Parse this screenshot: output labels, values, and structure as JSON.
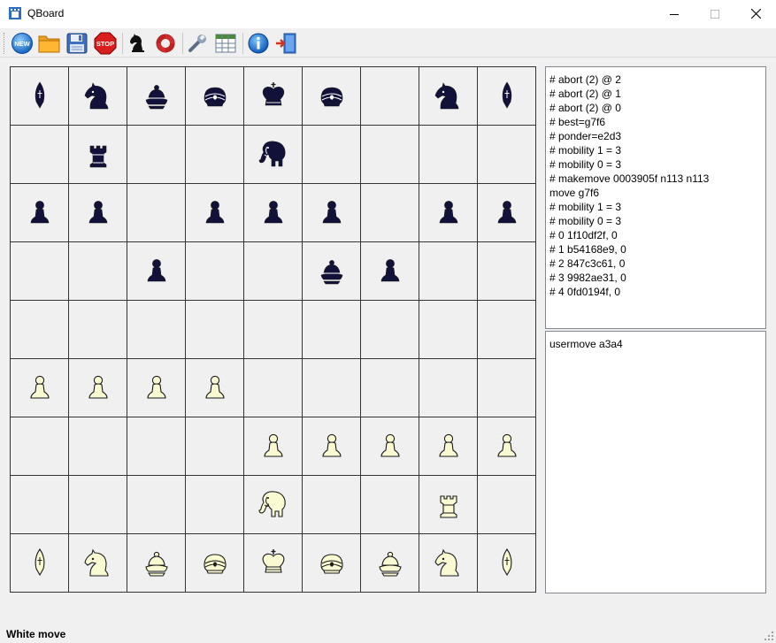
{
  "window": {
    "title": "QBoard",
    "controls": [
      "minimize",
      "maximize",
      "close"
    ]
  },
  "toolbar": {
    "buttons": [
      {
        "name": "new",
        "icon": "new-icon",
        "text": "NEW"
      },
      {
        "name": "open",
        "icon": "folder-icon"
      },
      {
        "name": "save",
        "icon": "floppy-icon"
      },
      {
        "name": "stop",
        "icon": "stop-icon",
        "text": "STOP"
      },
      {
        "name": "engine",
        "icon": "knight-icon"
      },
      {
        "name": "help-engine",
        "icon": "lifebuoy-icon"
      },
      {
        "name": "settings",
        "icon": "wrench-icon"
      },
      {
        "name": "table",
        "icon": "table-icon"
      },
      {
        "name": "about",
        "icon": "info-icon"
      },
      {
        "name": "exit",
        "icon": "exit-icon"
      }
    ]
  },
  "board": {
    "files": 9,
    "ranks": 9,
    "colors": {
      "dark_side": "#11113a",
      "light_side": "#fafad2",
      "outline": "#1a1a1a",
      "grid": "#333333"
    },
    "pieces": [
      {
        "row": 0,
        "col": 0,
        "side": "dark",
        "type": "bishop"
      },
      {
        "row": 0,
        "col": 1,
        "side": "dark",
        "type": "knight"
      },
      {
        "row": 0,
        "col": 2,
        "side": "dark",
        "type": "general"
      },
      {
        "row": 0,
        "col": 3,
        "side": "dark",
        "type": "turban"
      },
      {
        "row": 0,
        "col": 4,
        "side": "dark",
        "type": "king"
      },
      {
        "row": 0,
        "col": 5,
        "side": "dark",
        "type": "turban"
      },
      {
        "row": 0,
        "col": 7,
        "side": "dark",
        "type": "knight"
      },
      {
        "row": 0,
        "col": 8,
        "side": "dark",
        "type": "bishop"
      },
      {
        "row": 1,
        "col": 1,
        "side": "dark",
        "type": "rook"
      },
      {
        "row": 1,
        "col": 4,
        "side": "dark",
        "type": "elephant"
      },
      {
        "row": 2,
        "col": 0,
        "side": "dark",
        "type": "pawn"
      },
      {
        "row": 2,
        "col": 1,
        "side": "dark",
        "type": "pawn"
      },
      {
        "row": 2,
        "col": 3,
        "side": "dark",
        "type": "pawn"
      },
      {
        "row": 2,
        "col": 4,
        "side": "dark",
        "type": "pawn"
      },
      {
        "row": 2,
        "col": 5,
        "side": "dark",
        "type": "pawn"
      },
      {
        "row": 2,
        "col": 7,
        "side": "dark",
        "type": "pawn"
      },
      {
        "row": 2,
        "col": 8,
        "side": "dark",
        "type": "pawn"
      },
      {
        "row": 3,
        "col": 2,
        "side": "dark",
        "type": "pawn"
      },
      {
        "row": 3,
        "col": 5,
        "side": "dark",
        "type": "general"
      },
      {
        "row": 3,
        "col": 6,
        "side": "dark",
        "type": "pawn"
      },
      {
        "row": 5,
        "col": 0,
        "side": "light",
        "type": "pawn"
      },
      {
        "row": 5,
        "col": 1,
        "side": "light",
        "type": "pawn"
      },
      {
        "row": 5,
        "col": 2,
        "side": "light",
        "type": "pawn"
      },
      {
        "row": 5,
        "col": 3,
        "side": "light",
        "type": "pawn"
      },
      {
        "row": 6,
        "col": 4,
        "side": "light",
        "type": "pawn"
      },
      {
        "row": 6,
        "col": 5,
        "side": "light",
        "type": "pawn"
      },
      {
        "row": 6,
        "col": 6,
        "side": "light",
        "type": "pawn"
      },
      {
        "row": 6,
        "col": 7,
        "side": "light",
        "type": "pawn"
      },
      {
        "row": 6,
        "col": 8,
        "side": "light",
        "type": "pawn"
      },
      {
        "row": 7,
        "col": 4,
        "side": "light",
        "type": "elephant"
      },
      {
        "row": 7,
        "col": 7,
        "side": "light",
        "type": "rook"
      },
      {
        "row": 8,
        "col": 0,
        "side": "light",
        "type": "bishop"
      },
      {
        "row": 8,
        "col": 1,
        "side": "light",
        "type": "knight"
      },
      {
        "row": 8,
        "col": 2,
        "side": "light",
        "type": "general"
      },
      {
        "row": 8,
        "col": 3,
        "side": "light",
        "type": "turban"
      },
      {
        "row": 8,
        "col": 4,
        "side": "light",
        "type": "king"
      },
      {
        "row": 8,
        "col": 5,
        "side": "light",
        "type": "turban"
      },
      {
        "row": 8,
        "col": 6,
        "side": "light",
        "type": "general"
      },
      {
        "row": 8,
        "col": 7,
        "side": "light",
        "type": "knight"
      },
      {
        "row": 8,
        "col": 8,
        "side": "light",
        "type": "bishop"
      }
    ]
  },
  "engine_log": {
    "lines": [
      "# abort (2) @ 2",
      "# abort (2) @ 1",
      "# abort (2) @ 0",
      "# best=g7f6",
      "# ponder=e2d3",
      "# mobility 1 = 3",
      "# mobility 0 = 3",
      "# makemove 0003905f n113 n113",
      "move g7f6",
      "# mobility 1 = 3",
      "# mobility 0 = 3",
      "# 0 1f10df2f, 0",
      "# 1 b54168e9, 0",
      "# 2 847c3c61, 0",
      "# 3 9982ae31, 0",
      "# 4 0fd0194f, 0"
    ]
  },
  "command_log": {
    "lines": [
      "usermove a3a4"
    ]
  },
  "status": {
    "text": "White move"
  }
}
